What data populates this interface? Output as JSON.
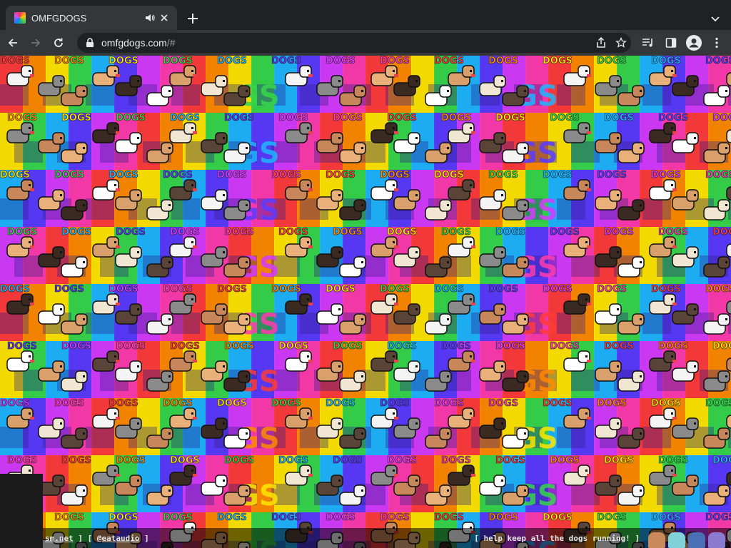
{
  "tab": {
    "title": "OMFGDOGS",
    "favicon": "omfgdogs-favicon",
    "audio_icon": "speaker-icon",
    "close_icon": "close-icon"
  },
  "toolbar": {
    "url_host": "omfgdogs.com",
    "url_path": "/#"
  },
  "page": {
    "tile_text": "DOGS",
    "footer": {
      "link1": "sm.net",
      "sep1": " ] [ ",
      "link2": "@eataudio",
      "sep2": " ]",
      "cta": "[ help keep all the dogs running! ]"
    }
  },
  "colors": {
    "rainbow": [
      "#ff3b3b",
      "#ff8a00",
      "#ffe600",
      "#36d64b",
      "#1fb5ff",
      "#5b3bff",
      "#d63bff",
      "#ff3bb0"
    ],
    "chrome_dark": "#202124",
    "chrome_toolbar": "#35363a"
  }
}
